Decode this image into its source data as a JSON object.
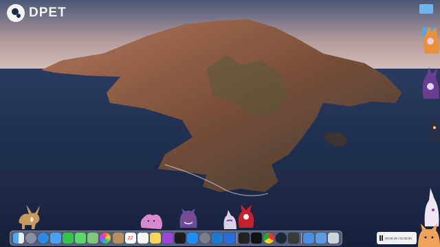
{
  "brand": {
    "name": "DPET"
  },
  "media_player": {
    "time": "00:00:29 / 01:00:00",
    "state": "paused"
  },
  "dock": {
    "apps": [
      "finder-icon",
      "launchpad-icon",
      "safari-icon",
      "mail-icon",
      "facetime-icon",
      "messages-icon",
      "maps-icon",
      "photos-icon",
      "contacts-icon",
      "calendar-icon",
      "reminders-icon",
      "notes-icon",
      "podcasts-icon",
      "tv-icon",
      "appstore-icon",
      "system-preferences-icon",
      "vscode-icon",
      "xcode-icon",
      "terminal-icon",
      "activity-monitor-icon",
      "chrome-icon",
      "steam-icon",
      "settings-icon",
      "folder-icon",
      "downloads-icon",
      "trash-icon"
    ],
    "calendar_day": "22"
  },
  "colors": {
    "sky": "#c6b7b6",
    "sea": "#1d2f55",
    "island": "#8a5a3d",
    "accent_white": "#f4f4f4"
  }
}
